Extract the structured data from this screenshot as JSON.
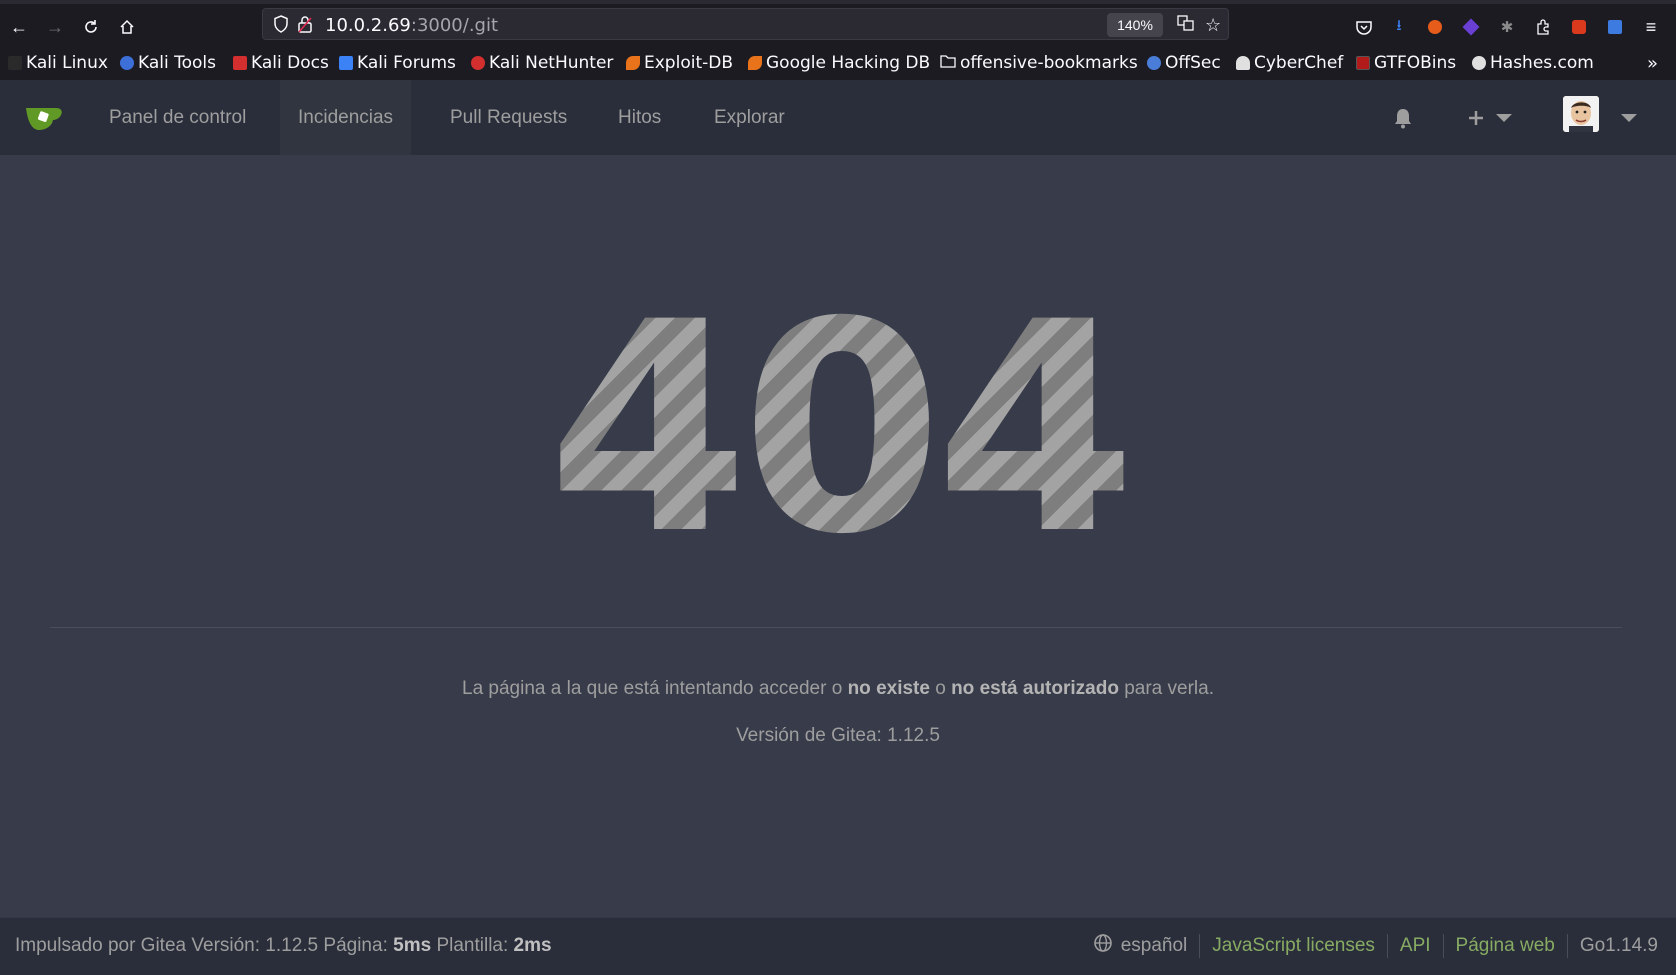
{
  "browser": {
    "url_host": "10.0.2.69",
    "url_rest": ":3000/.git",
    "zoom": "140%",
    "bookmarks": [
      {
        "label": "Kali Linux",
        "color": "#2a2a2a"
      },
      {
        "label": "Kali Tools",
        "color": "#3d6fd9"
      },
      {
        "label": "Kali Docs",
        "color": "#d32f2f"
      },
      {
        "label": "Kali Forums",
        "color": "#3b82f6"
      },
      {
        "label": "Kali NetHunter",
        "color": "#d32f2f"
      },
      {
        "label": "Exploit-DB",
        "color": "#e8731a"
      },
      {
        "label": "Google Hacking DB",
        "color": "#e8731a"
      },
      {
        "label": "offensive-bookmarks",
        "color": "folder"
      },
      {
        "label": "OffSec",
        "color": "#4a7dd8"
      },
      {
        "label": "CyberChef",
        "color": "#e0e0e0"
      },
      {
        "label": "GTFOBins",
        "color": "#b31b1b"
      },
      {
        "label": "Hashes.com",
        "color": "#e0e0e0"
      }
    ]
  },
  "nav": {
    "items": [
      "Panel de control",
      "Incidencias",
      "Pull Requests",
      "Hitos",
      "Explorar"
    ],
    "active_index": 1,
    "logo_color": "#609926"
  },
  "error": {
    "code": "404",
    "msg_pre": "La página a la que está intentando acceder o ",
    "msg_b1": "no existe",
    "msg_mid": " o ",
    "msg_b2": "no está autorizado",
    "msg_post": " para verla.",
    "version": "Versión de Gitea: 1.12.5"
  },
  "footer": {
    "powered_pre": "Impulsado por Gitea Versión: 1.12.5 Página: ",
    "page_time": "5ms",
    "template_label": " Plantilla: ",
    "template_time": "2ms",
    "language": "español",
    "links": [
      "JavaScript licenses",
      "API",
      "Página web"
    ],
    "go_version": "Go1.14.9",
    "link_color": "#87ab63"
  }
}
